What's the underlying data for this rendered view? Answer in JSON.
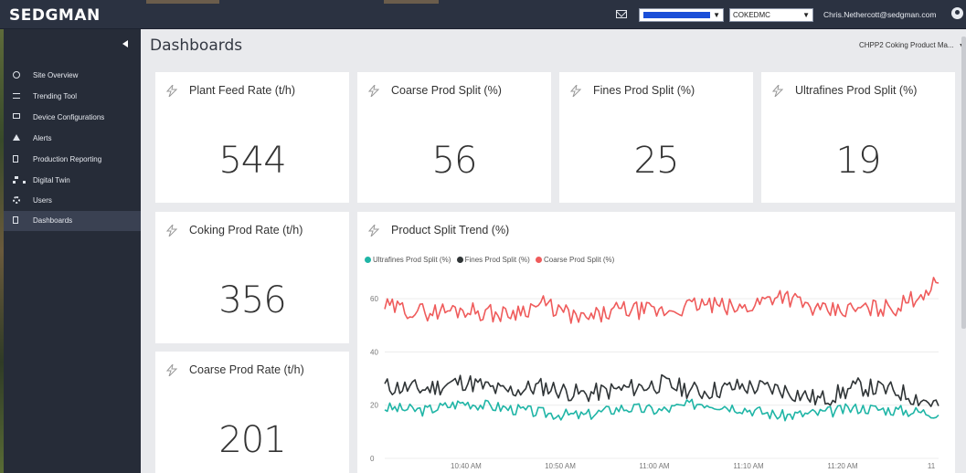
{
  "header": {
    "logo": "SEDGMAN",
    "site_select_value": "",
    "company_select_value": "COKEDMC",
    "user_email": "Chris.Nethercott@sedgman.com"
  },
  "sidebar": {
    "items": [
      {
        "label": "Site Overview",
        "icon": "circle-icon"
      },
      {
        "label": "Trending Tool",
        "icon": "list-icon"
      },
      {
        "label": "Device Configurations",
        "icon": "monitor-icon"
      },
      {
        "label": "Alerts",
        "icon": "warning-icon"
      },
      {
        "label": "Production Reporting",
        "icon": "document-icon"
      },
      {
        "label": "Digital Twin",
        "icon": "hierarchy-icon"
      },
      {
        "label": "Users",
        "icon": "gear-icon"
      },
      {
        "label": "Dashboards",
        "icon": "document-icon",
        "active": true
      }
    ]
  },
  "main": {
    "title": "Dashboards",
    "dashboard_select": "CHPP2 Coking Product Ma...",
    "cards": [
      {
        "title": "Plant Feed Rate (t/h)",
        "value": "544"
      },
      {
        "title": "Coarse Prod Split (%)",
        "value": "56"
      },
      {
        "title": "Fines Prod Split (%)",
        "value": "25"
      },
      {
        "title": "Ultrafines Prod Split (%)",
        "value": "19"
      },
      {
        "title": "Coking Prod Rate (t/h)",
        "value": "356"
      },
      {
        "title": "Coarse Prod Rate (t/h)",
        "value": "201"
      }
    ],
    "trend": {
      "title": "Product Split Trend (%)"
    }
  },
  "colors": {
    "ultrafines": "#1fb5a6",
    "fines": "#2f3436",
    "coarse": "#ef5b5b"
  },
  "chart_data": {
    "type": "line",
    "title": "Product Split Trend (%)",
    "xlabel": "",
    "ylabel": "",
    "ylim": [
      0,
      70
    ],
    "yticks": [
      "0",
      "20",
      "40",
      "60"
    ],
    "xticks": [
      "10:40 AM",
      "10:50 AM",
      "11:00 AM",
      "11:10 AM",
      "11:20 AM",
      "11"
    ],
    "x": [
      "10:32",
      "10:36",
      "10:40",
      "10:44",
      "10:48",
      "10:52",
      "10:56",
      "11:00",
      "11:04",
      "11:08",
      "11:12",
      "11:16",
      "11:20",
      "11:24",
      "11:28"
    ],
    "series": [
      {
        "name": "Ultrafines Prod Split (%)",
        "values": [
          19,
          18,
          21,
          19,
          17,
          16,
          19,
          18,
          21,
          19,
          16,
          17,
          19,
          18,
          17
        ]
      },
      {
        "name": "Fines Prod Split (%)",
        "values": [
          27,
          26,
          29,
          25,
          27,
          24,
          26,
          28,
          25,
          27,
          26,
          22,
          27,
          25,
          20
        ]
      },
      {
        "name": "Coarse Prod Split (%)",
        "values": [
          57,
          55,
          56,
          54,
          58,
          52,
          56,
          55,
          58,
          56,
          62,
          55,
          56,
          57,
          66
        ]
      }
    ],
    "legend": "top-left",
    "grid": true
  }
}
